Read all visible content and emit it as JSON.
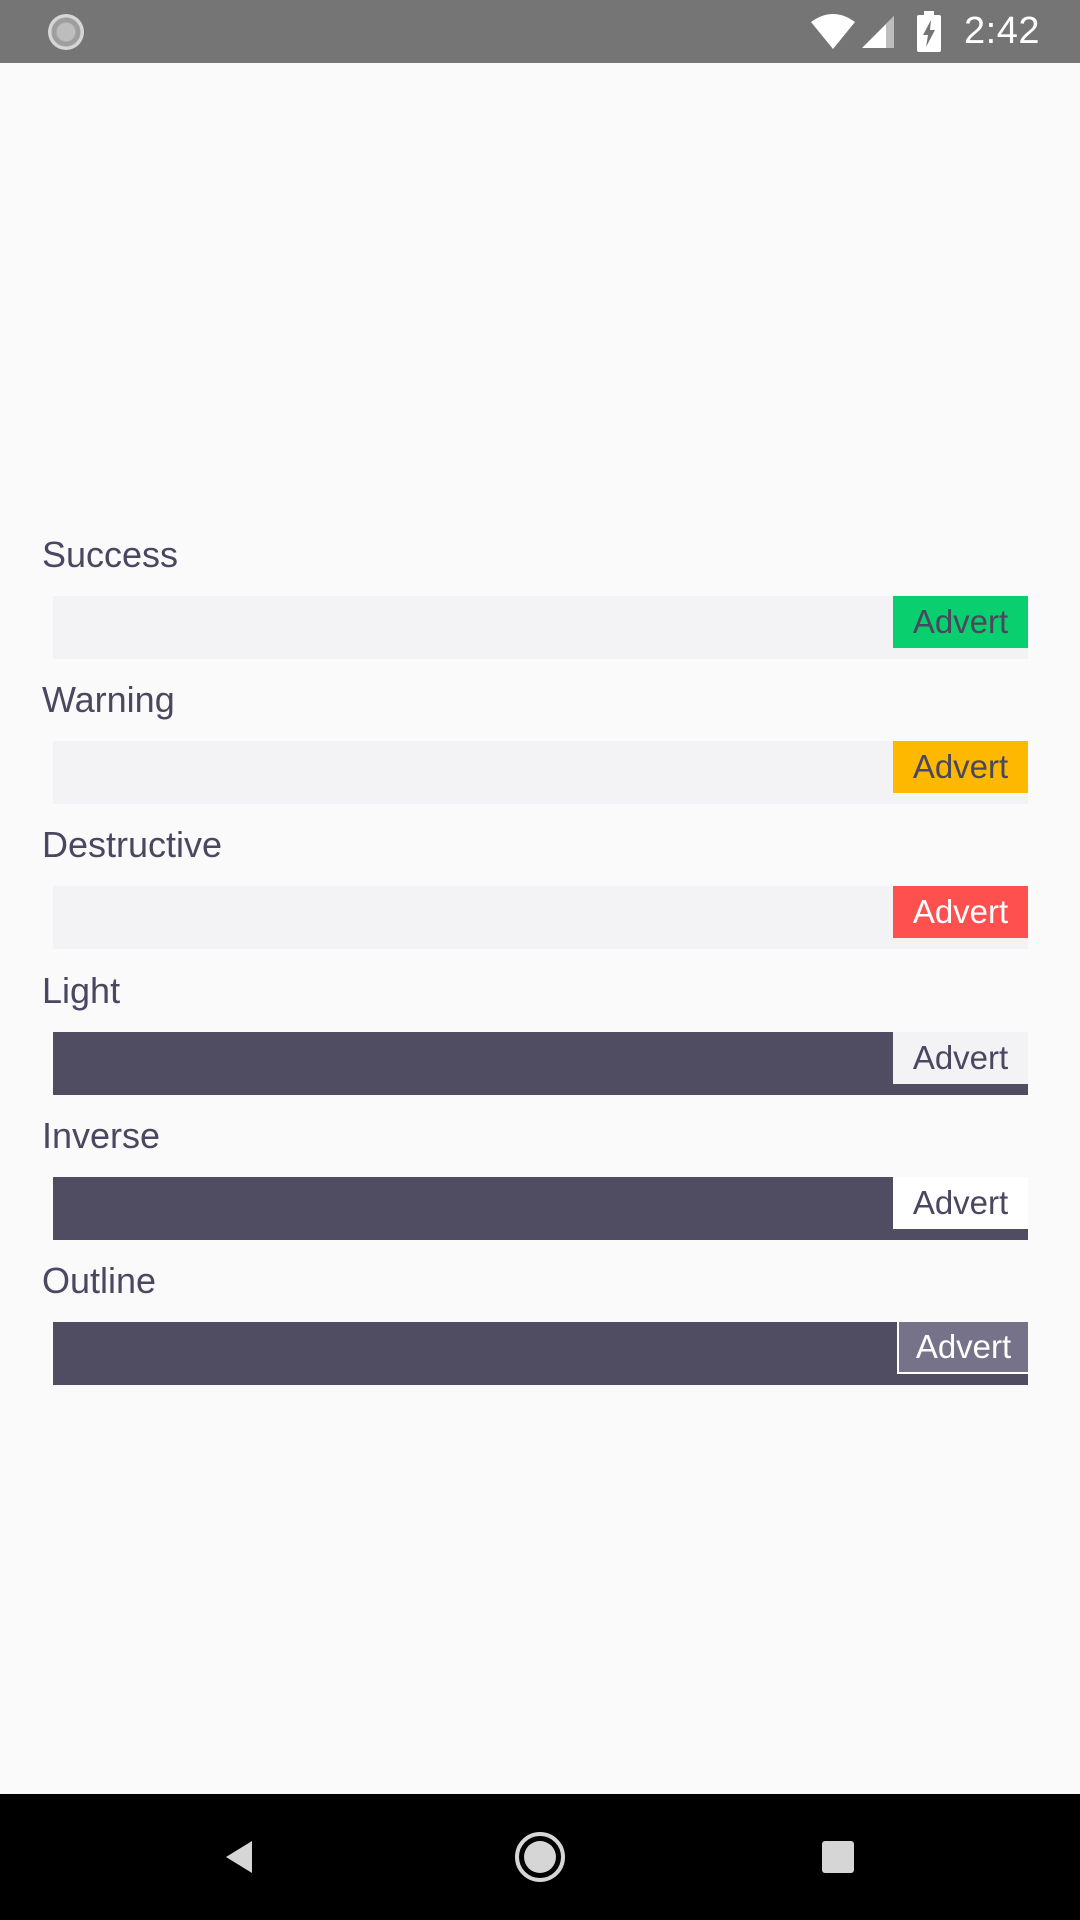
{
  "status_bar": {
    "time": "2:42",
    "icons": [
      "loading-indicator-icon",
      "wifi-icon",
      "cellular-signal-icon",
      "battery-charging-icon"
    ]
  },
  "sections": [
    {
      "label": "Success",
      "advert": "Advert",
      "style": "success",
      "bar_color": "#f3f3f5",
      "badge_bg": "#0acf6f",
      "badge_text": "#4a4861"
    },
    {
      "label": "Warning",
      "advert": "Advert",
      "style": "warning",
      "bar_color": "#f3f3f5",
      "badge_bg": "#ffb800",
      "badge_text": "#4a4861"
    },
    {
      "label": "Destructive",
      "advert": "Advert",
      "style": "destructive",
      "bar_color": "#f3f3f5",
      "badge_bg": "#ff5050",
      "badge_text": "#ffffff"
    },
    {
      "label": "Light",
      "advert": "Advert",
      "style": "light",
      "bar_color": "#504d62",
      "badge_bg": "#f3f3f5",
      "badge_text": "#4a4861"
    },
    {
      "label": "Inverse",
      "advert": "Advert",
      "style": "inverse",
      "bar_color": "#504d62",
      "badge_bg": "#ffffff",
      "badge_text": "#4a4861"
    },
    {
      "label": "Outline",
      "advert": "Advert",
      "style": "outline",
      "bar_color": "#504d62",
      "badge_bg": "#75728a",
      "badge_text": "#ffffff"
    }
  ],
  "nav_bar": {
    "icons": [
      "back-icon",
      "home-icon",
      "recents-icon"
    ]
  }
}
